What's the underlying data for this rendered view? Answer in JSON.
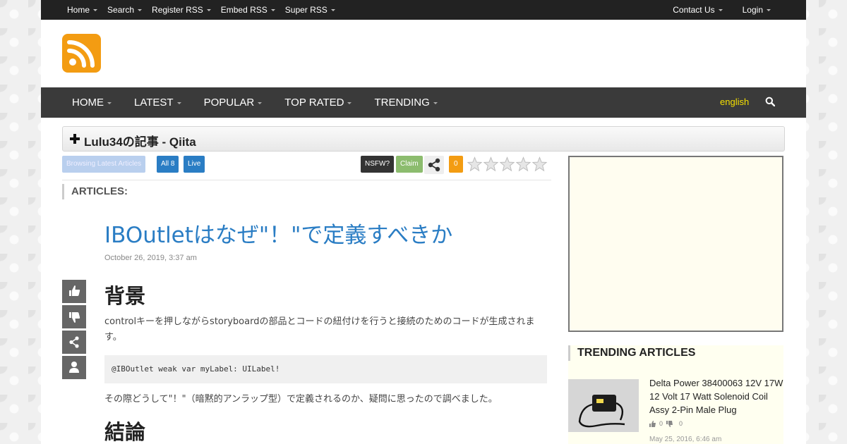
{
  "topbar": {
    "left": [
      "Home",
      "Search",
      "Register RSS",
      "Embed RSS",
      "Super RSS"
    ],
    "right": [
      "Contact Us",
      "Login"
    ]
  },
  "mainnav": {
    "items": [
      "HOME",
      "LATEST",
      "POPULAR",
      "TOP RATED",
      "TRENDING"
    ],
    "language": "english"
  },
  "feed": {
    "title": "Lulu34の記事 - Qiita",
    "browse_label": "Browsing Latest Articles",
    "all_label": "All 8",
    "live_label": "Live",
    "nsfw_label": "NSFW?",
    "claim_label": "Claim",
    "rating_count": "0",
    "rating_stars": 0
  },
  "section": {
    "articles_heading": "ARTICLES:"
  },
  "article": {
    "title": "IBOutletはなぜ\"！\"で定義すべきか",
    "date": "October 26, 2019, 3:37 am",
    "heading1": "背景",
    "para1": "controlキーを押しながらstoryboardの部品とコードの紐付けを行うと接続のためのコードが生成されます。",
    "code": "@IBOutlet weak var myLabel: UILabel!",
    "para2": "その際どうして\"！\"（暗黙的アンラップ型）で定義されるのか、疑問に思ったので調べました。",
    "heading2": "結論"
  },
  "trending": {
    "heading": "TRENDING ARTICLES",
    "item": {
      "title": "Delta Power 38400063 12V 17W 12 Volt 17 Watt Solenoid Coil Assy 2-Pin Male Plug",
      "likes": "0",
      "dislikes": "0",
      "date": "May 25, 2016, 6:46 am"
    }
  },
  "colors": {
    "accent": "#2a7dc4",
    "logo": "#f39c12",
    "topbar": "#222222",
    "nav": "#3a3a3a",
    "language": "#f5e000"
  }
}
